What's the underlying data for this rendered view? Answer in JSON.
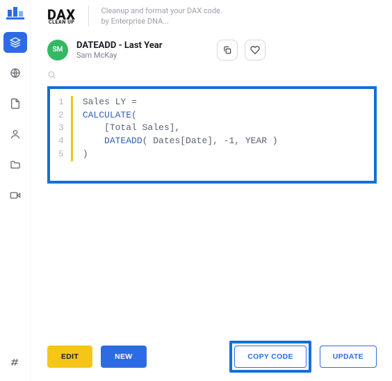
{
  "brand": {
    "name": "DAX",
    "sub": "CLEAN UP"
  },
  "tagline": {
    "line1": "Cleanup and format your DAX code.",
    "line2": "by Enterprise DNA..."
  },
  "doc": {
    "title": "DATEADD - Last Year",
    "author": "Sam McKay",
    "avatar_initials": "SM"
  },
  "code": {
    "lines": [
      "1",
      "2",
      "3",
      "4",
      "5"
    ],
    "l1_a": "Sales LY =",
    "l2_kw": "CALCULATE",
    "l2_b": "(",
    "l3_a": "    [Total Sales],",
    "l4_pad": "    ",
    "l4_kw": "DATEADD",
    "l4_b": "( Dates[Date], -1, YEAR )",
    "l5_a": ")"
  },
  "footer": {
    "edit": "EDIT",
    "new": "NEW",
    "copy": "COPY CODE",
    "update": "UPDATE"
  },
  "colors": {
    "accent": "#2d6be4",
    "highlight": "#156fd4",
    "edit": "#f5c518",
    "avatar": "#33b864"
  }
}
